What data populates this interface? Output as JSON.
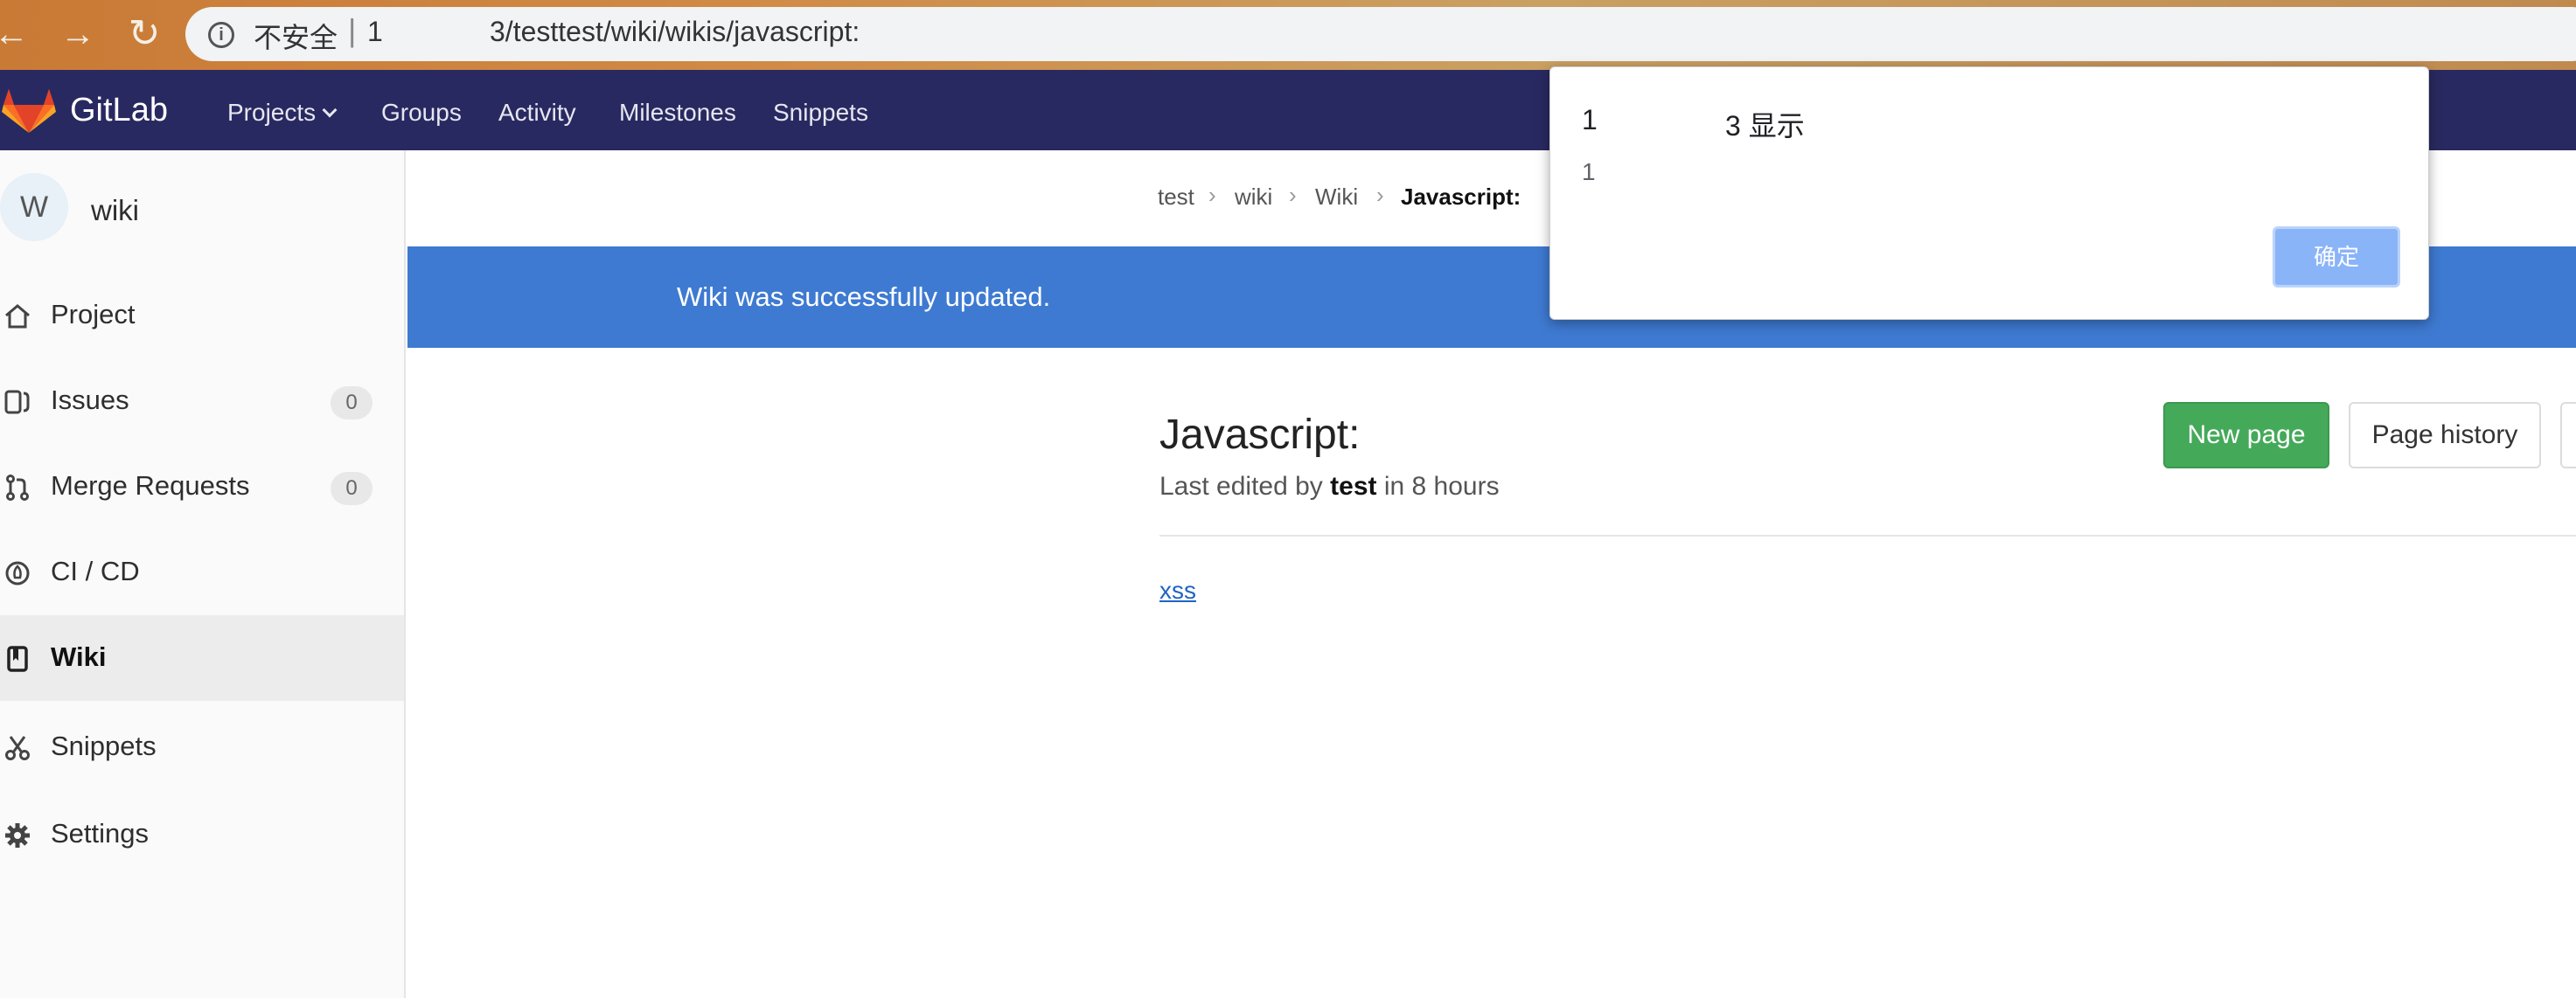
{
  "browser": {
    "back_glyph": "←",
    "forward_glyph": "→",
    "reload_glyph": "↻",
    "info_glyph": "i",
    "security_label": "不安全",
    "separator": "|",
    "url_start": "1",
    "url_rest": "3/testtest/wiki/wikis/javascript:"
  },
  "header": {
    "brand": "GitLab",
    "nav": [
      "Projects",
      "Groups",
      "Activity",
      "Milestones",
      "Snippets"
    ]
  },
  "sidebar": {
    "avatar_letter": "W",
    "project_name": "wiki",
    "items": [
      {
        "label": "Project",
        "icon": "home-icon"
      },
      {
        "label": "Issues",
        "icon": "issues-icon",
        "count": "0"
      },
      {
        "label": "Merge Requests",
        "icon": "merge-request-icon",
        "count": "0"
      },
      {
        "label": "CI / CD",
        "icon": "rocket-icon"
      },
      {
        "label": "Wiki",
        "icon": "book-icon",
        "active": true
      },
      {
        "label": "Snippets",
        "icon": "scissors-icon"
      },
      {
        "label": "Settings",
        "icon": "gear-icon"
      }
    ]
  },
  "breadcrumb": [
    "test",
    "wiki",
    "Wiki",
    "Javascript:"
  ],
  "flash": {
    "message": "Wiki was successfully updated."
  },
  "page": {
    "title": "Javascript:",
    "meta_prefix": "Last edited by",
    "meta_author": "test",
    "meta_suffix": "in 8 hours",
    "new_page_button": "New page",
    "page_history_button": "Page history",
    "content_link": "xss"
  },
  "dialog": {
    "title_start": "1",
    "title_end": "3 显示",
    "message": "1",
    "ok_button": "确定"
  },
  "colors": {
    "header": "#292961",
    "flash": "#3e7ad1",
    "new_page_button": "#45a95a",
    "dialog_ok": "#8ab4f8"
  }
}
